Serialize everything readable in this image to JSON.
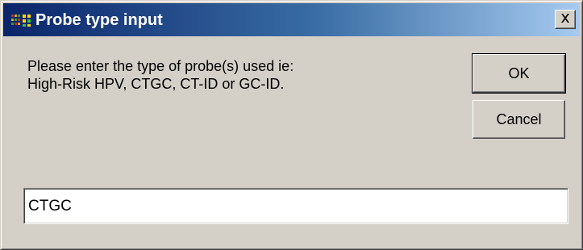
{
  "window": {
    "title": "Probe type input",
    "icon": "app-icon",
    "close_icon": "close-icon"
  },
  "dialog": {
    "prompt_line1": "Please enter the type of probe(s) used ie:",
    "prompt_line2": "High-Risk HPV, CTGC, CT-ID or GC-ID.",
    "ok_label": "OK",
    "cancel_label": "Cancel",
    "input_value": "CTGC"
  },
  "colors": {
    "title_active_start": "#0a246a",
    "title_active_end": "#a6caf0",
    "face": "#d4d0c8"
  }
}
